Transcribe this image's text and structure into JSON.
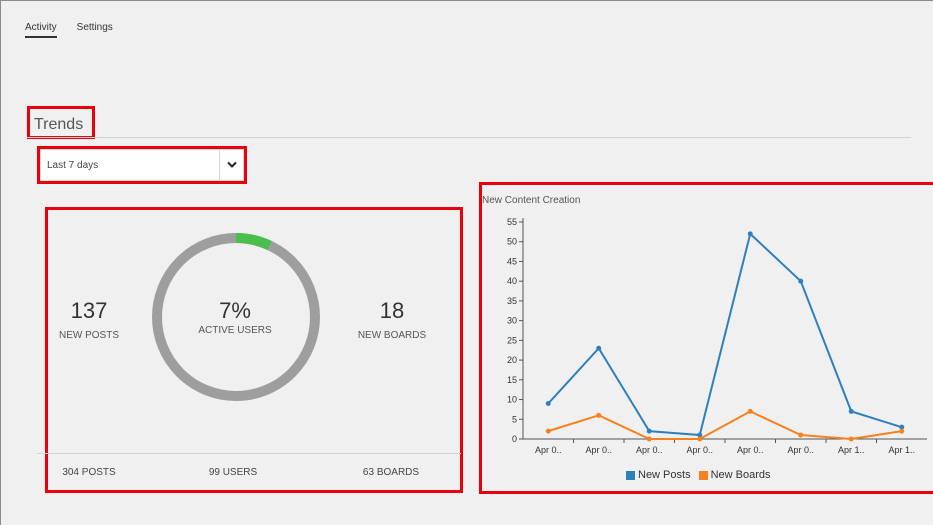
{
  "tabs": [
    {
      "label": "Activity",
      "active": true
    },
    {
      "label": "Settings",
      "active": false
    }
  ],
  "section_title": "Trends",
  "range_select": {
    "value": "Last 7 days"
  },
  "stats": {
    "posts": {
      "value": "137",
      "label": "NEW POSTS"
    },
    "active_users": {
      "value": "7%",
      "label": "ACTIVE USERS",
      "fraction": 0.07
    },
    "boards": {
      "value": "18",
      "label": "NEW BOARDS"
    },
    "totals": {
      "posts": "304 POSTS",
      "users": "99 USERS",
      "boards": "63 BOARDS"
    }
  },
  "colors": {
    "red_highlight": "#e8000b",
    "ring_track": "#9e9e9e",
    "ring_fill": "#4bbf4b",
    "posts_series": "#2e7fbd",
    "boards_series": "#f5821f"
  },
  "chart_data": {
    "type": "line",
    "title": "New Content Creation",
    "categories": [
      "Apr 0..",
      "Apr 0..",
      "Apr 0..",
      "Apr 0..",
      "Apr 0..",
      "Apr 0..",
      "Apr 1..",
      "Apr 1.."
    ],
    "series": [
      {
        "name": "New Posts",
        "values": [
          9,
          23,
          2,
          1,
          52,
          40,
          7,
          3
        ]
      },
      {
        "name": "New Boards",
        "values": [
          2,
          6,
          0,
          0,
          7,
          1,
          0,
          2
        ]
      }
    ],
    "ylim": [
      0,
      55
    ],
    "yticks": [
      0,
      5,
      10,
      15,
      20,
      25,
      30,
      35,
      40,
      45,
      50,
      55
    ],
    "legend_position": "bottom"
  }
}
